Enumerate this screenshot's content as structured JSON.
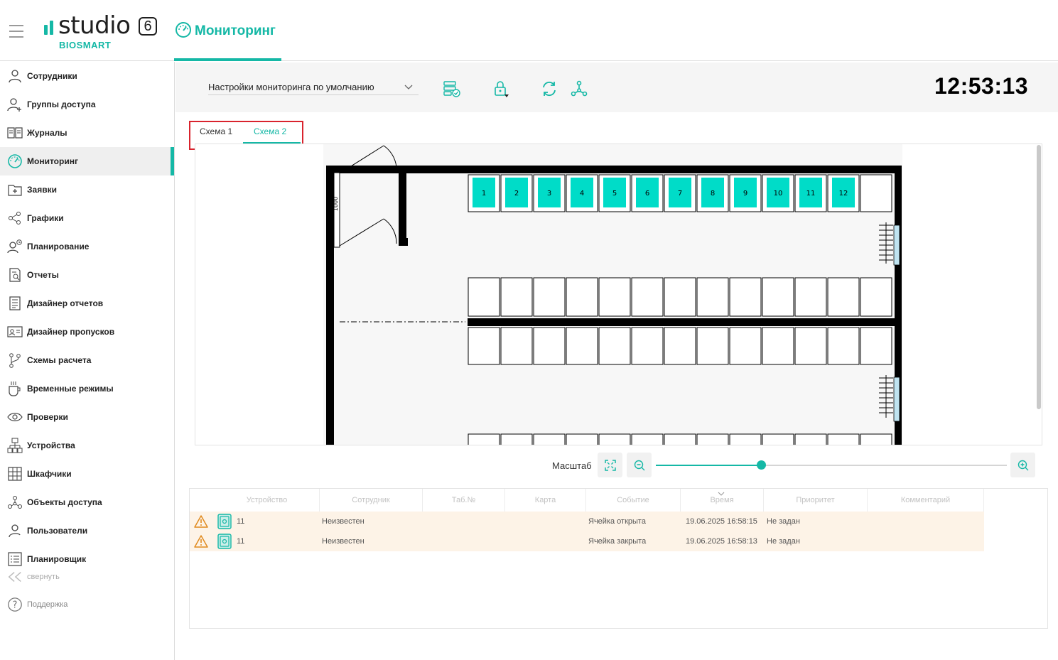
{
  "header": {
    "logo_text": "studio",
    "logo_version": "6",
    "logo_sub": "BIOSMART",
    "page_title": "Мониторинг"
  },
  "sidebar": {
    "items": [
      {
        "label": "Сотрудники",
        "icon": "user-icon"
      },
      {
        "label": "Группы доступа",
        "icon": "user-group-icon"
      },
      {
        "label": "Журналы",
        "icon": "book-icon"
      },
      {
        "label": "Мониторинг",
        "icon": "gauge-icon",
        "active": true
      },
      {
        "label": "Заявки",
        "icon": "folder-plus-icon"
      },
      {
        "label": "Графики",
        "icon": "share-icon"
      },
      {
        "label": "Планирование",
        "icon": "user-clock-icon"
      },
      {
        "label": "Отчеты",
        "icon": "report-icon"
      },
      {
        "label": "Дизайнер отчетов",
        "icon": "report-designer-icon"
      },
      {
        "label": "Дизайнер пропусков",
        "icon": "id-card-icon"
      },
      {
        "label": "Схемы расчета",
        "icon": "branch-icon"
      },
      {
        "label": "Временные режимы",
        "icon": "cup-icon"
      },
      {
        "label": "Проверки",
        "icon": "eye-icon"
      },
      {
        "label": "Устройства",
        "icon": "network-icon"
      },
      {
        "label": "Шкафчики",
        "icon": "lockers-icon"
      },
      {
        "label": "Объекты доступа",
        "icon": "nodes-icon"
      },
      {
        "label": "Пользователи",
        "icon": "user-add-icon"
      },
      {
        "label": "Планировщик",
        "icon": "list-icon"
      }
    ],
    "collapse_label": "свернуть",
    "support_label": "Поддержка"
  },
  "toolbar": {
    "settings_value": "Настройки мониторинга по умолчанию",
    "clock": "12:53:13"
  },
  "tabs": [
    "Схема 1",
    "Схема 2"
  ],
  "schema": {
    "door_label": "1000",
    "occupied_lockers": [
      "1",
      "2",
      "3",
      "4",
      "5",
      "6",
      "7",
      "8",
      "9",
      "10",
      "11",
      "12"
    ],
    "locker_color": "#00dcc8"
  },
  "zoom": {
    "label": "Масштаб",
    "level": 0.3
  },
  "events": {
    "columns": [
      "Устройство",
      "Сотрудник",
      "Таб.№",
      "Карта",
      "Событие",
      "Время",
      "Приоритет",
      "Комментарий"
    ],
    "rows": [
      {
        "device": "11",
        "employee": "Неизвестен",
        "tab": "",
        "card": "",
        "event": "Ячейка открыта",
        "time": "19.06.2025 16:58:15",
        "priority": "Не задан",
        "comment": ""
      },
      {
        "device": "11",
        "employee": "Неизвестен",
        "tab": "",
        "card": "",
        "event": "Ячейка закрыта",
        "time": "19.06.2025 16:58:13",
        "priority": "Не задан",
        "comment": ""
      }
    ]
  },
  "colors": {
    "accent": "#15b8a6",
    "highlight_border": "#d9232d",
    "warning_row": "#fdf3e7"
  }
}
